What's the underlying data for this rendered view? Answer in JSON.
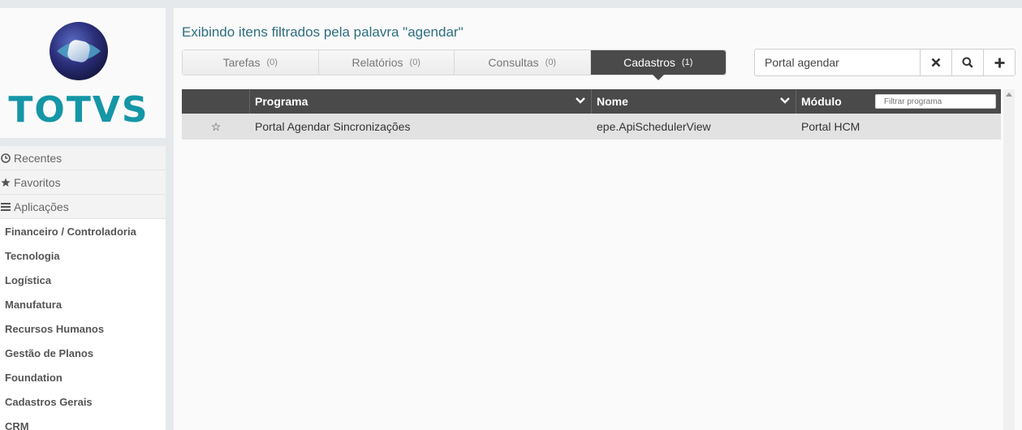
{
  "brand": {
    "name": "TOTVS",
    "color": "#1596a6"
  },
  "sidebar": {
    "sections": [
      {
        "label": "Recentes",
        "icon": "clock-icon"
      },
      {
        "label": "Favoritos",
        "icon": "star-icon"
      },
      {
        "label": "Aplicações",
        "icon": "list-icon"
      }
    ],
    "items": [
      "Financeiro / Controladoria",
      "Tecnologia",
      "Logística",
      "Manufatura",
      "Recursos Humanos",
      "Gestão de Planos",
      "Foundation",
      "Cadastros Gerais",
      "CRM"
    ]
  },
  "main": {
    "title": "Exibindo itens filtrados pela palavra \"agendar\"",
    "tabs": [
      {
        "label": "Tarefas",
        "count": "(0)"
      },
      {
        "label": "Relatórios",
        "count": "(0)"
      },
      {
        "label": "Consultas",
        "count": "(0)"
      },
      {
        "label": "Cadastros",
        "count": "(1)",
        "active": true
      }
    ],
    "search": {
      "value": "Portal agendar"
    }
  },
  "grid": {
    "columns": [
      "Programa",
      "Nome",
      "Módulo"
    ],
    "filter_placeholder": "Filtrar programa",
    "rows": [
      {
        "favorite": "☆",
        "programa": "Portal Agendar Sincronizações",
        "nome": "epe.ApiSchedulerView",
        "modulo": "Portal HCM"
      }
    ]
  },
  "colors": {
    "title": "#2e6f80",
    "header_bg": "#4a4a4a",
    "row_bg": "#e2e2e2",
    "active_tab": "#4a4a4a"
  }
}
